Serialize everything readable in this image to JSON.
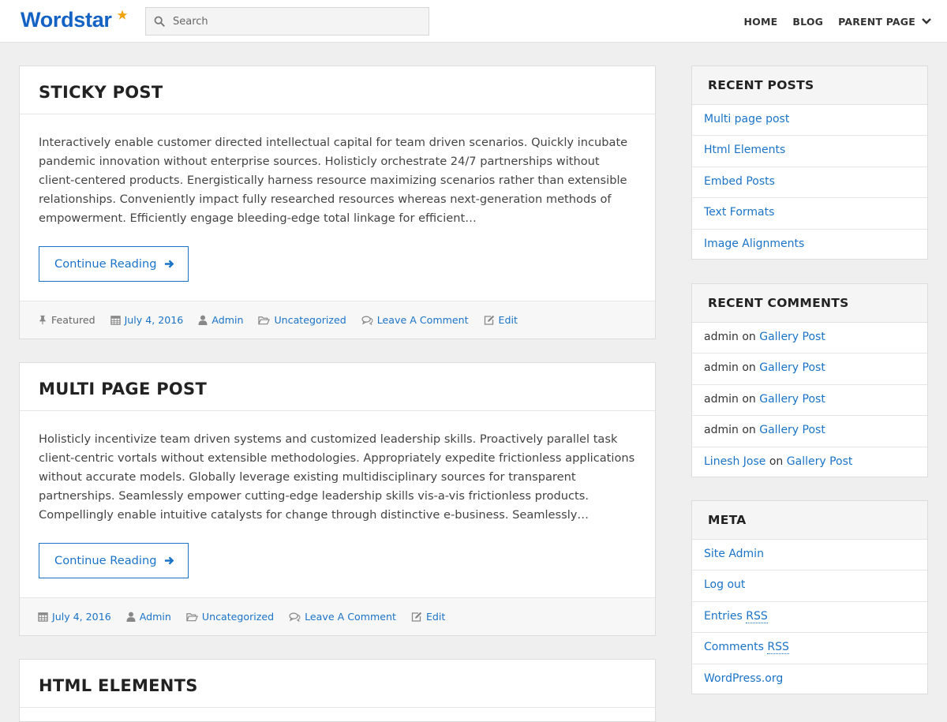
{
  "header": {
    "logo": "Wordstar",
    "search_placeholder": "Search",
    "nav": [
      {
        "label": "HOME"
      },
      {
        "label": "BLOG"
      },
      {
        "label": "PARENT PAGE"
      }
    ]
  },
  "posts": [
    {
      "title": "STICKY POST",
      "excerpt": "Interactively enable customer directed intellectual capital for team driven scenarios. Quickly incubate pandemic innovation without enterprise sources. Holisticly orchestrate 24/7 partnerships without client-centered products. Energistically harness resource maximizing scenarios rather than extensible relationships. Conveniently impact fully researched resources whereas next-generation methods of empowerment. Efficiently engage bleeding-edge total linkage for efficient…",
      "continue_label": "Continue Reading",
      "meta": {
        "featured": "Featured",
        "date": "July 4, 2016",
        "author": "Admin",
        "category": "Uncategorized",
        "comments": "Leave A Comment",
        "edit": "Edit"
      }
    },
    {
      "title": "MULTI PAGE POST",
      "excerpt": "Holisticly incentivize team driven systems and customized leadership skills. Proactively parallel task client-centric vortals without extensible methodologies. Appropriately expedite frictionless applications without accurate models. Globally leverage existing multidisciplinary sources for transparent partnerships. Seamlessly empower cutting-edge leadership skills vis-a-vis frictionless products. Compellingly enable intuitive catalysts for change through distinctive e-business. Seamlessly…",
      "continue_label": "Continue Reading",
      "meta": {
        "date": "July 4, 2016",
        "author": "Admin",
        "category": "Uncategorized",
        "comments": "Leave A Comment",
        "edit": "Edit"
      }
    },
    {
      "title": "HTML ELEMENTS"
    }
  ],
  "sidebar": {
    "recent_posts": {
      "title": "RECENT POSTS",
      "items": [
        "Multi page post",
        "Html Elements",
        "Embed Posts",
        "Text Formats",
        "Image Alignments"
      ]
    },
    "recent_comments": {
      "title": "RECENT COMMENTS",
      "on_word": "on",
      "items": [
        {
          "author": "admin",
          "post": "Gallery Post"
        },
        {
          "author": "admin",
          "post": "Gallery Post"
        },
        {
          "author": "admin",
          "post": "Gallery Post"
        },
        {
          "author": "admin",
          "post": "Gallery Post"
        },
        {
          "author": "Linesh Jose",
          "post": "Gallery Post"
        }
      ]
    },
    "meta": {
      "title": "META",
      "site_admin": "Site Admin",
      "log_out": "Log out",
      "entries_prefix": "Entries ",
      "comments_prefix": "Comments ",
      "rss": "RSS",
      "wordpress": "WordPress.org"
    }
  },
  "colors": {
    "brand": "#1463c4",
    "link": "#1a73c7",
    "star": "#f0a30a",
    "page_bg": "#efefef"
  }
}
